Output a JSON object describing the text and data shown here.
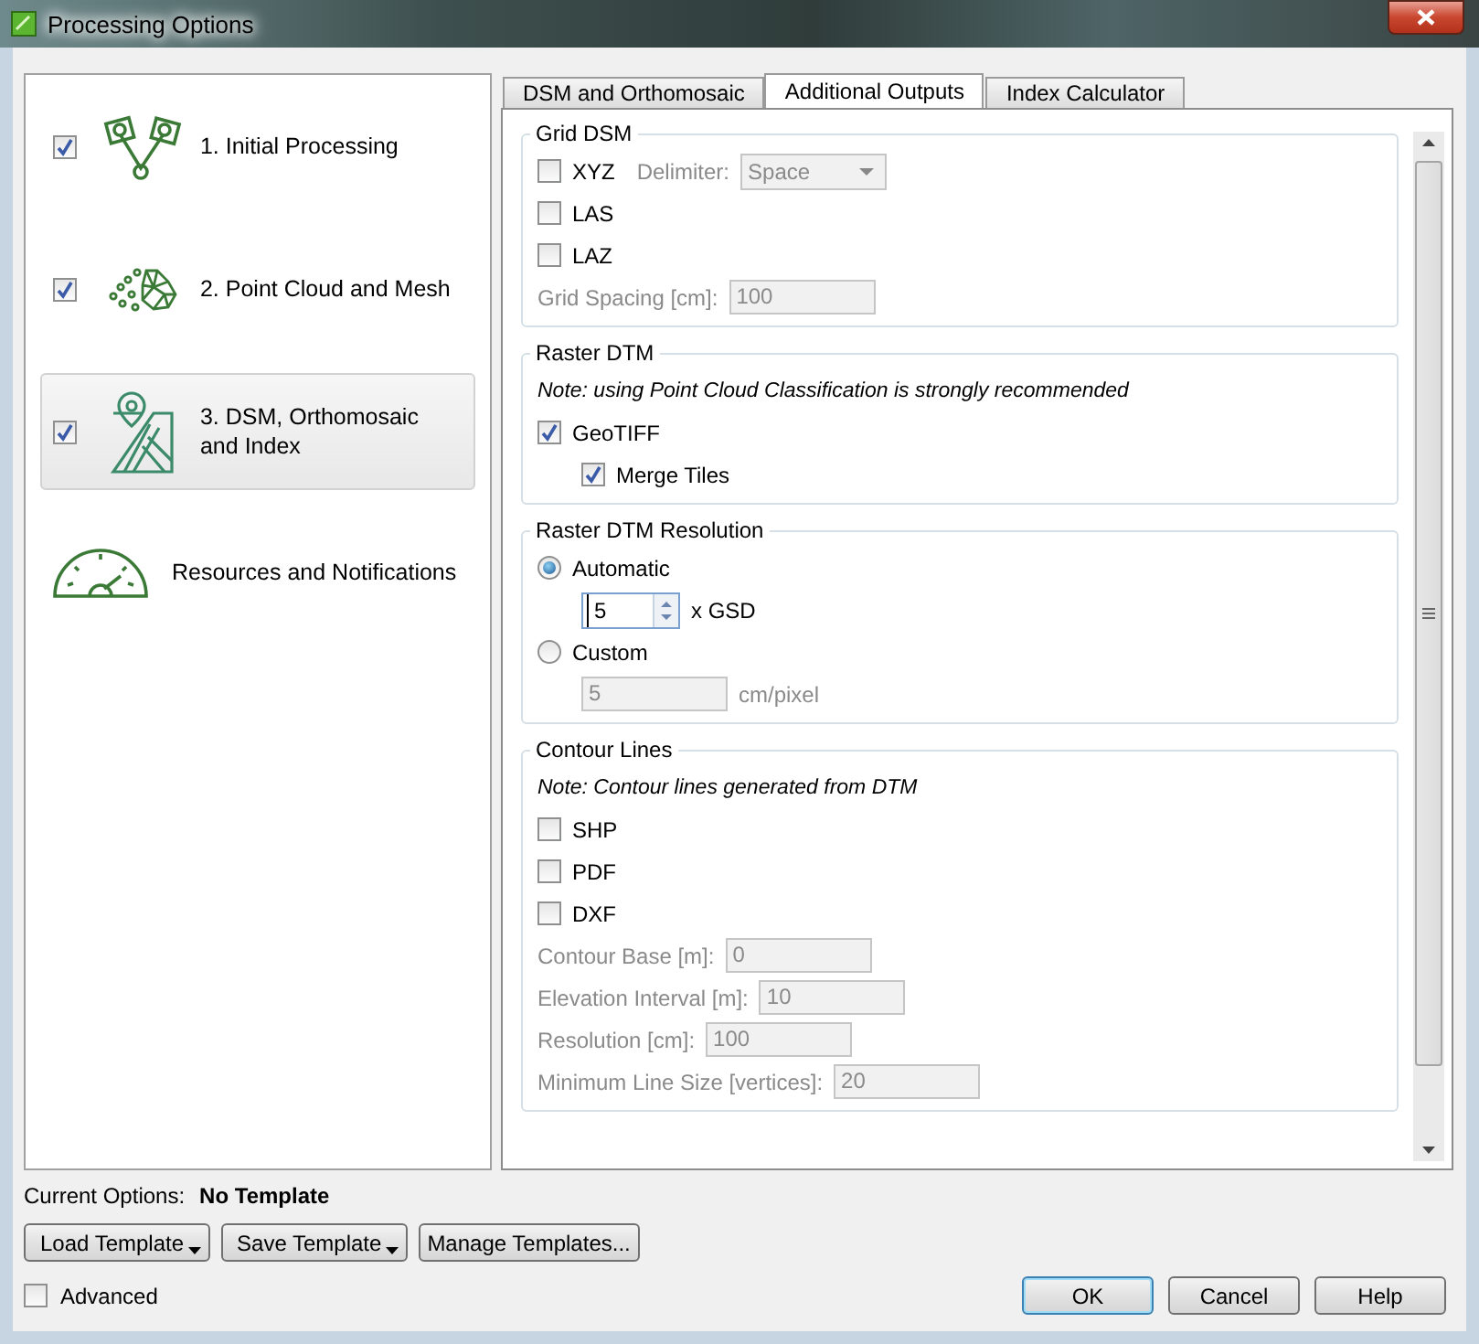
{
  "window": {
    "title": "Processing Options"
  },
  "steps": [
    {
      "kind": "cameras",
      "label": "1. Initial Processing",
      "checked": true,
      "selected": false
    },
    {
      "kind": "cloud",
      "label": "2. Point Cloud and Mesh",
      "checked": true,
      "selected": false
    },
    {
      "kind": "map",
      "label": "3. DSM, Orthomosaic and Index",
      "checked": true,
      "selected": true
    }
  ],
  "resources": {
    "label": "Resources and Notifications"
  },
  "tabs": [
    {
      "label": "DSM and Orthomosaic",
      "selected": false
    },
    {
      "label": "Additional Outputs",
      "selected": true
    },
    {
      "label": "Index Calculator",
      "selected": false
    }
  ],
  "groups": [
    {
      "title": "Grid DSM",
      "items": [
        {
          "kind": "checkbox",
          "label": "XYZ",
          "checked": false,
          "select": {
            "label": "Delimiter:",
            "value": "Space",
            "disabled": true
          }
        },
        {
          "kind": "checkbox",
          "label": "LAS",
          "checked": false
        },
        {
          "kind": "checkbox",
          "label": "LAZ",
          "checked": false
        },
        {
          "kind": "field",
          "label": "Grid Spacing [cm]:",
          "value": "100",
          "disabled": true
        }
      ]
    },
    {
      "title": "Raster DTM",
      "items": [
        {
          "kind": "note",
          "text": "Note: using Point Cloud Classification is strongly recommended"
        },
        {
          "kind": "checkbox",
          "label": "GeoTIFF",
          "checked": true,
          "children": [
            {
              "kind": "checkbox",
              "label": "Merge Tiles",
              "checked": true
            }
          ]
        }
      ]
    },
    {
      "title": "Raster DTM Resolution",
      "items": [
        {
          "kind": "radio",
          "label": "Automatic",
          "selected": true,
          "children": [
            {
              "kind": "spin",
              "value": "5",
              "unit": "x GSD",
              "disabled": false
            }
          ]
        },
        {
          "kind": "radio",
          "label": "Custom",
          "selected": false,
          "children": [
            {
              "kind": "field",
              "value": "5",
              "unit": "cm/pixel",
              "disabled": true
            }
          ]
        }
      ]
    },
    {
      "title": "Contour Lines",
      "items": [
        {
          "kind": "note",
          "text": "Note: Contour lines generated from DTM"
        },
        {
          "kind": "checkbox",
          "label": "SHP",
          "checked": false
        },
        {
          "kind": "checkbox",
          "label": "PDF",
          "checked": false
        },
        {
          "kind": "checkbox",
          "label": "DXF",
          "checked": false
        },
        {
          "kind": "field",
          "label": "Contour Base [m]:",
          "value": "0",
          "disabled": true
        },
        {
          "kind": "field",
          "label": "Elevation Interval [m]:",
          "value": "10",
          "disabled": true
        },
        {
          "kind": "field",
          "label": "Resolution [cm]:",
          "value": "100",
          "disabled": true
        },
        {
          "kind": "field",
          "label": "Minimum Line Size [vertices]:",
          "value": "20",
          "disabled": true
        }
      ]
    }
  ],
  "current_options": {
    "label": "Current Options:",
    "value": "No Template"
  },
  "template_buttons": [
    {
      "label": "Load Template",
      "menu": true
    },
    {
      "label": "Save Template",
      "menu": true
    },
    {
      "label": "Manage Templates...",
      "menu": false
    }
  ],
  "advanced": {
    "label": "Advanced",
    "checked": false
  },
  "dialog_buttons": [
    {
      "label": "OK",
      "default": true
    },
    {
      "label": "Cancel",
      "default": false
    },
    {
      "label": "Help",
      "default": false
    }
  ]
}
